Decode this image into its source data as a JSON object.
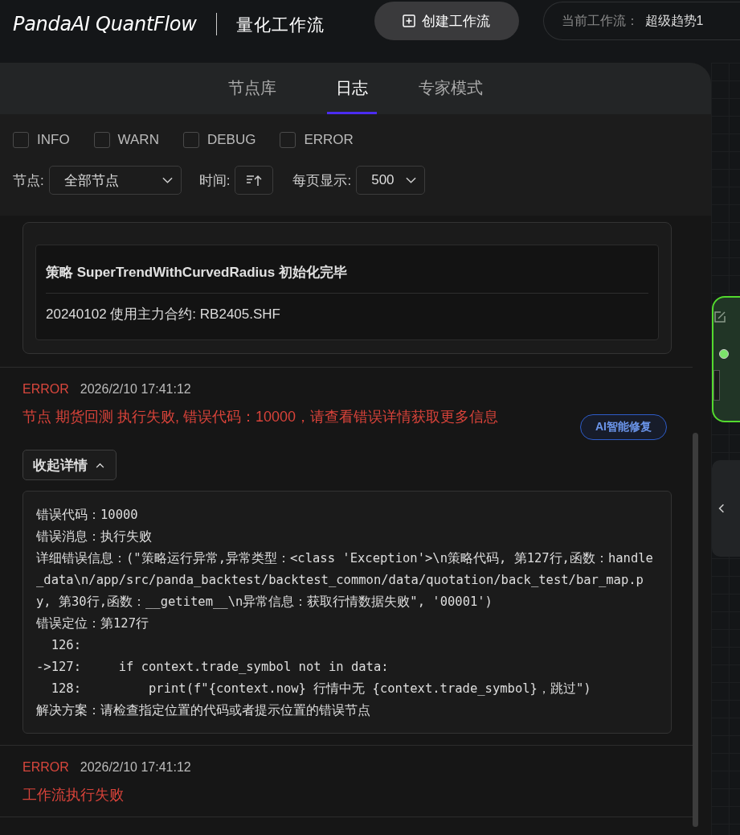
{
  "header": {
    "logo": "PandaAI QuantFlow",
    "subtitle": "量化工作流",
    "create_button": "创建工作流",
    "current_label": "当前工作流：",
    "current_value": "超级趋势1"
  },
  "tabs": [
    {
      "label": "节点库",
      "selected": false
    },
    {
      "label": "日志",
      "selected": true
    },
    {
      "label": "专家模式",
      "selected": false
    }
  ],
  "filters": {
    "levels": [
      {
        "label": "INFO",
        "checked": false
      },
      {
        "label": "WARN",
        "checked": false
      },
      {
        "label": "DEBUG",
        "checked": false
      },
      {
        "label": "ERROR",
        "checked": false
      }
    ],
    "node_label": "节点:",
    "node_select": "全部节点",
    "time_label": "时间:",
    "page_label": "每页显示:",
    "page_select": "500"
  },
  "logs": [
    {
      "kind": "message_box",
      "lines": [
        "策略 SuperTrendWithCurvedRadius 初始化完毕",
        "20240102 使用主力合约: RB2405.SHF"
      ]
    },
    {
      "kind": "error",
      "level": "ERROR",
      "time": "2026/2/10 17:41:12",
      "message": "节点 期货回测 执行失败, 错误代码：10000，请查看错误详情获取更多信息",
      "ai_button": "AI智能修复",
      "toggle_button": "收起详情",
      "expanded": true,
      "details": [
        "错误代码：10000",
        "错误消息：执行失败",
        "详细错误信息：(\"策略运行异常,异常类型：<class 'Exception'>\\n策略代码, 第127行,函数：handle_data\\n/app/src/panda_backtest/backtest_common/data/quotation/back_test/bar_map.py, 第30行,函数：__getitem__\\n异常信息：获取行情数据失败\", '00001')",
        "错误定位：第127行",
        "  126:",
        "->127:     if context.trade_symbol not in data:",
        "  128:         print(f\"{context.now} 行情中无 {context.trade_symbol}，跳过\")",
        "解决方案：请检查指定位置的代码或者提示位置的错误节点"
      ]
    },
    {
      "kind": "error",
      "level": "ERROR",
      "time": "2026/2/10 17:41:12",
      "message": "工作流执行失败"
    }
  ]
}
